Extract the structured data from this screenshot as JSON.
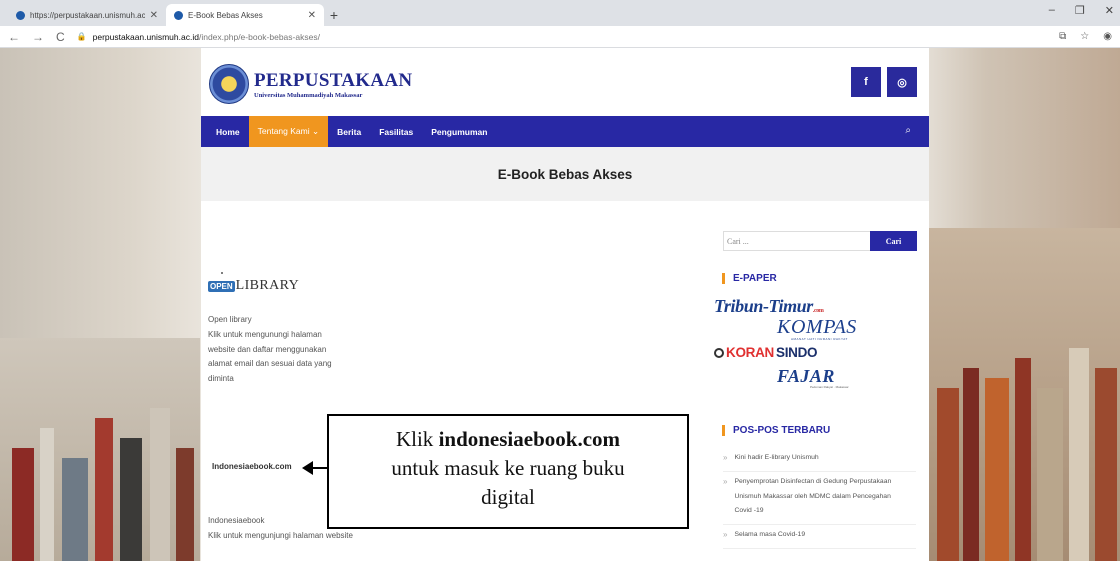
{
  "browser": {
    "tabs": [
      {
        "title": "https://perpustakaan.unismuh.ac",
        "close": "✕"
      },
      {
        "title": "E-Book Bebas Akses",
        "close": "✕"
      }
    ],
    "new_tab": "+",
    "window_controls": [
      "–",
      "❐",
      "✕"
    ],
    "back": "←",
    "forward": "→",
    "reload": "C",
    "url_host": "perpustakaan.unismuh.ac.id",
    "url_path": "/index.php/e-book-bebas-akses/"
  },
  "site": {
    "logo_title": "PERPUSTAKAAN",
    "logo_subtitle": "Universitas Muhammadiyah Makassar",
    "social": {
      "facebook": "f",
      "instagram": "◎"
    },
    "menu": [
      "Home",
      "Tentang Kami ⌄",
      "Berita",
      "Fasilitas",
      "Pengumuman"
    ],
    "menu_search_icon": "🔍",
    "page_title": "E-Book Bebas Akses"
  },
  "content": {
    "openlibrary_badge": "OPEN",
    "openlibrary_text": "LIBRARY",
    "openlibrary_desc": [
      "Open library",
      "Klik untuk mengunungi halaman",
      "website dan daftar menggunakan",
      "alamat email dan sesuai data yang",
      "diminta"
    ],
    "indonesiaebook_logo": "Indonesiaebook.com",
    "indonesiaebook_desc": [
      "Indonesiaebook",
      "Klik untuk mengunjungi halaman website"
    ]
  },
  "sidebar": {
    "search_placeholder": "Cari ...",
    "search_button": "Cari",
    "epaper_title": "E-PAPER",
    "tribun": "Tribun-Timur",
    "tribun_com": ".com",
    "kompas": "KOMPAS",
    "kompas_sub": "AMANAT HATI NURANI RAKYAT",
    "koran1": "KORAN",
    "koran2": "SINDO",
    "fajar": "FAJAR",
    "fajar_sub": "Pedoman Rakyat · Makassar",
    "posts_title": "POS-POS TERBARU",
    "posts": [
      [
        "Kini hadir E-library Unismuh"
      ],
      [
        "Penyemprotan Disinfectan di Gedung Perpustakaan",
        "Unismuh Makassar oleh MDMC dalam Pencegahan",
        "Covid -19"
      ],
      [
        "Selama masa Covid-19"
      ]
    ]
  },
  "callout": {
    "prefix": "Klik ",
    "bold": "indonesiaebook.com",
    "line2": "untuk masuk ke ruang buku",
    "line3": "digital"
  }
}
